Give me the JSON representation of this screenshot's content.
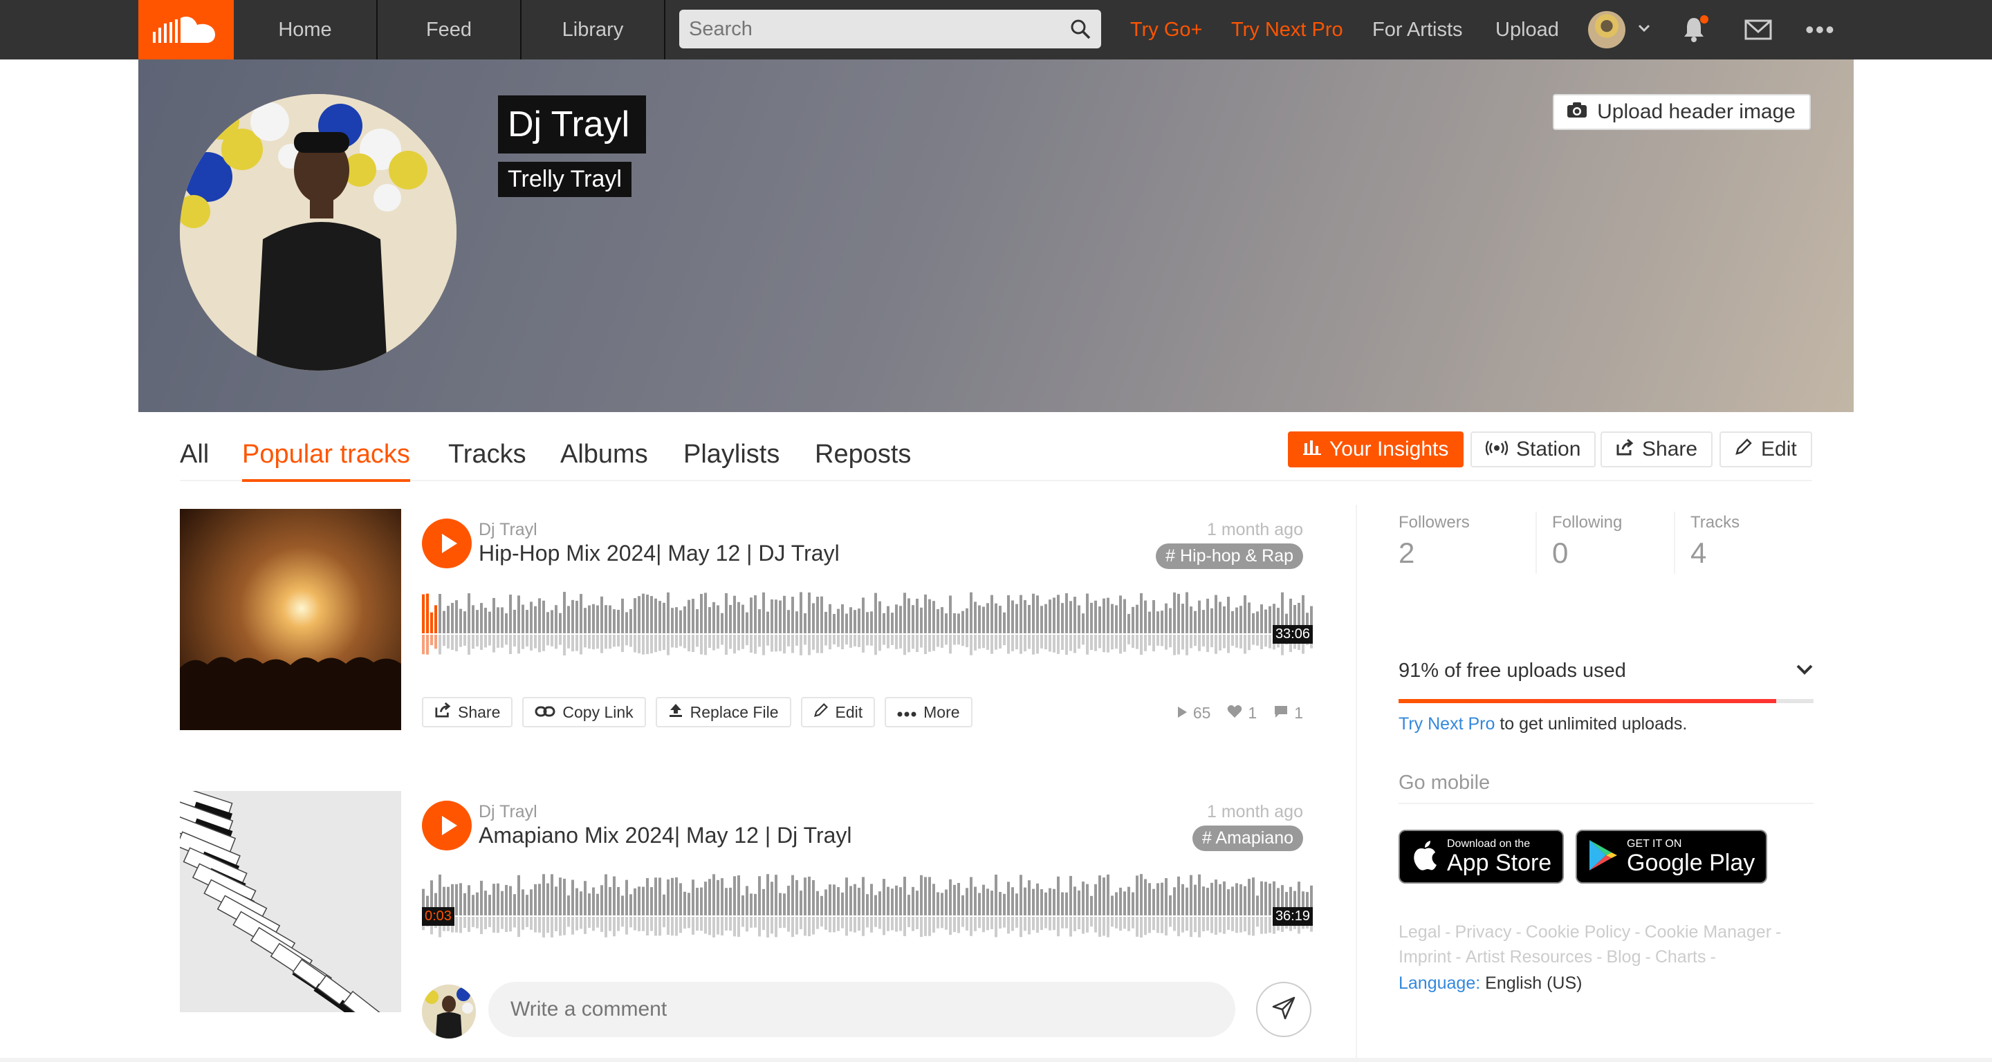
{
  "nav": {
    "tabs": [
      "Home",
      "Feed",
      "Library"
    ],
    "search_placeholder": "Search",
    "links": {
      "try_go": "Try Go+",
      "try_next_pro": "Try Next Pro",
      "for_artists": "For Artists",
      "upload": "Upload"
    },
    "more": "•••"
  },
  "profile": {
    "name": "Dj Trayl",
    "subtitle": "Trelly Trayl",
    "upload_header_label": "Upload header image"
  },
  "tabs": {
    "items": [
      "All",
      "Popular tracks",
      "Tracks",
      "Albums",
      "Playlists",
      "Reposts"
    ],
    "active": "Popular tracks"
  },
  "actions": {
    "insights": "Your Insights",
    "station": "Station",
    "share": "Share",
    "edit": "Edit"
  },
  "tracks": [
    {
      "user": "Dj Trayl",
      "title": "Hip-Hop Mix 2024| May 12 | DJ Trayl",
      "date": "1 month ago",
      "tag": "Hip-hop & Rap",
      "duration": "33:06",
      "progress": 0.015,
      "buttons": [
        "Share",
        "Copy Link",
        "Replace File",
        "Edit",
        "More"
      ],
      "plays": "65",
      "likes": "1",
      "comments": "1"
    },
    {
      "user": "Dj Trayl",
      "title": "Amapiano Mix 2024| May 12 | Dj Trayl",
      "date": "1 month ago",
      "tag": "Amapiano",
      "position": "0:03",
      "duration": "36:19",
      "comment_placeholder": "Write a comment"
    }
  ],
  "sidebar": {
    "stats": [
      {
        "label": "Followers",
        "value": "2"
      },
      {
        "label": "Following",
        "value": "0"
      },
      {
        "label": "Tracks",
        "value": "4"
      }
    ],
    "quota": {
      "label": "91% of free uploads used",
      "fraction": 0.91,
      "cta_link": "Try Next Pro",
      "cta_text": " to get unlimited uploads."
    },
    "go_mobile": "Go mobile",
    "app_store": {
      "small": "Download on the",
      "big": "App Store"
    },
    "google_play": {
      "small": "GET IT ON",
      "big": "Google Play"
    },
    "footer_links_1": [
      "Legal",
      "Privacy",
      "Cookie Policy",
      "Cookie Manager"
    ],
    "footer_links_2": [
      "Imprint",
      "Artist Resources",
      "Blog",
      "Charts"
    ],
    "language_label": "Language:",
    "language_value": "English (US)"
  },
  "colors": {
    "accent": "#ff5500",
    "nav_bg": "#333333",
    "link": "#3388dd"
  }
}
